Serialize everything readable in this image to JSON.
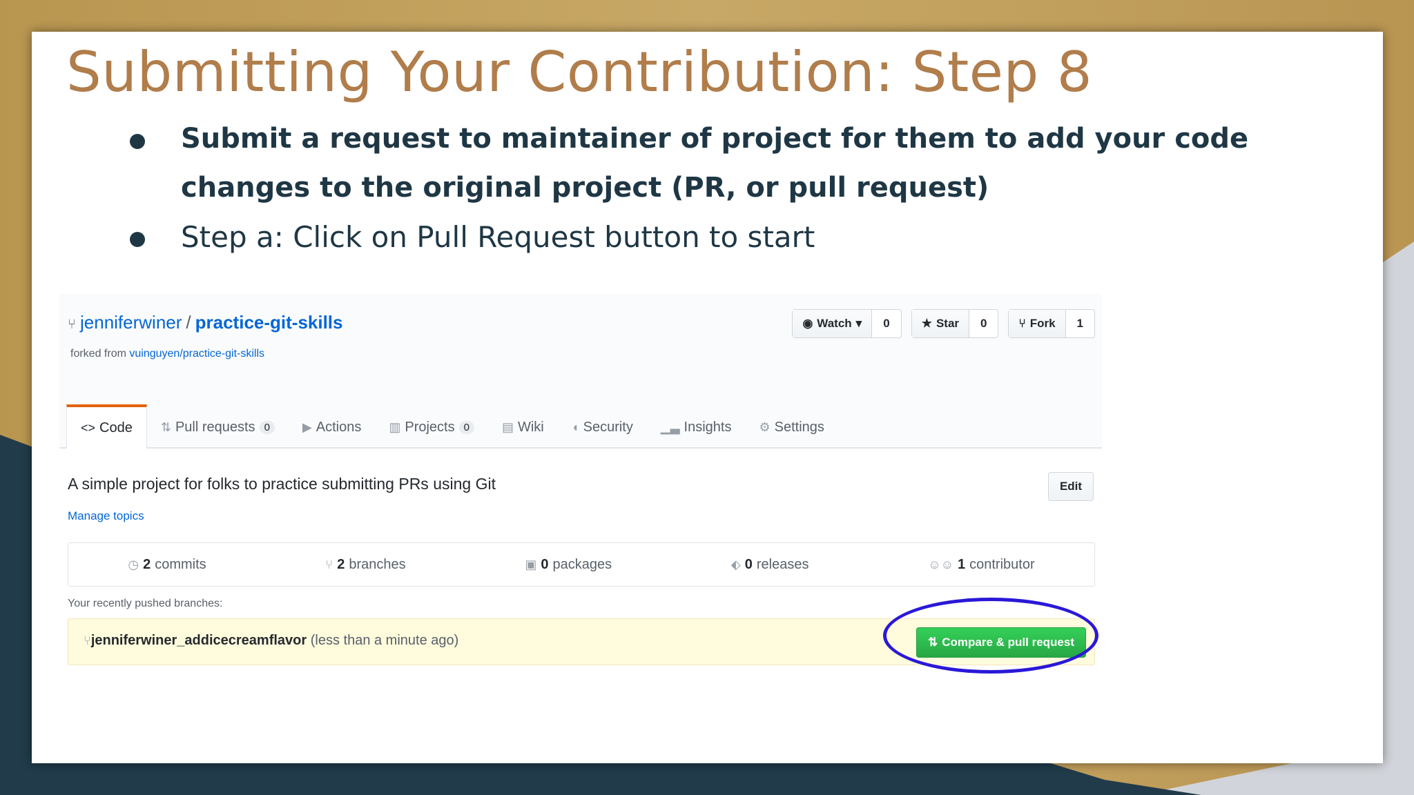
{
  "slide": {
    "title": "Submitting Your Contribution: Step 8",
    "bullets": [
      "Submit a request to maintainer of project for them to add your code changes to the original project (PR, or pull request)",
      "Step a: Click on Pull Request button to start"
    ]
  },
  "repo": {
    "owner": "jenniferwiner",
    "separator": "/",
    "name": "practice-git-skills",
    "forked_prefix": "forked from",
    "forked_link": "vuinguyen/practice-git-skills"
  },
  "actions": {
    "watch": {
      "label": "Watch",
      "count": "0"
    },
    "star": {
      "label": "Star",
      "count": "0"
    },
    "fork": {
      "label": "Fork",
      "count": "1"
    }
  },
  "tabs": {
    "code": "Code",
    "pull_requests": {
      "label": "Pull requests",
      "count": "0"
    },
    "actions": "Actions",
    "projects": {
      "label": "Projects",
      "count": "0"
    },
    "wiki": "Wiki",
    "security": "Security",
    "insights": "Insights",
    "settings": "Settings"
  },
  "description": "A simple project for folks to practice submitting PRs using Git",
  "manage_topics": "Manage topics",
  "edit_label": "Edit",
  "summary": {
    "commits": {
      "count": "2",
      "label": "commits"
    },
    "branches": {
      "count": "2",
      "label": "branches"
    },
    "packages": {
      "count": "0",
      "label": "packages"
    },
    "releases": {
      "count": "0",
      "label": "releases"
    },
    "contributors": {
      "count": "1",
      "label": "contributor"
    }
  },
  "recent_label": "Your recently pushed branches:",
  "pushed": {
    "branch": "jenniferwiner_addicecreamflavor",
    "time": "(less than a minute ago)"
  },
  "compare_button": "Compare & pull request",
  "colors": {
    "title": "#b07d4b",
    "bullet_text": "#1f3745",
    "link": "#0366d6",
    "green_button": "#28a745",
    "highlight_circle": "#2a18d8",
    "tab_accent": "#e36209"
  }
}
